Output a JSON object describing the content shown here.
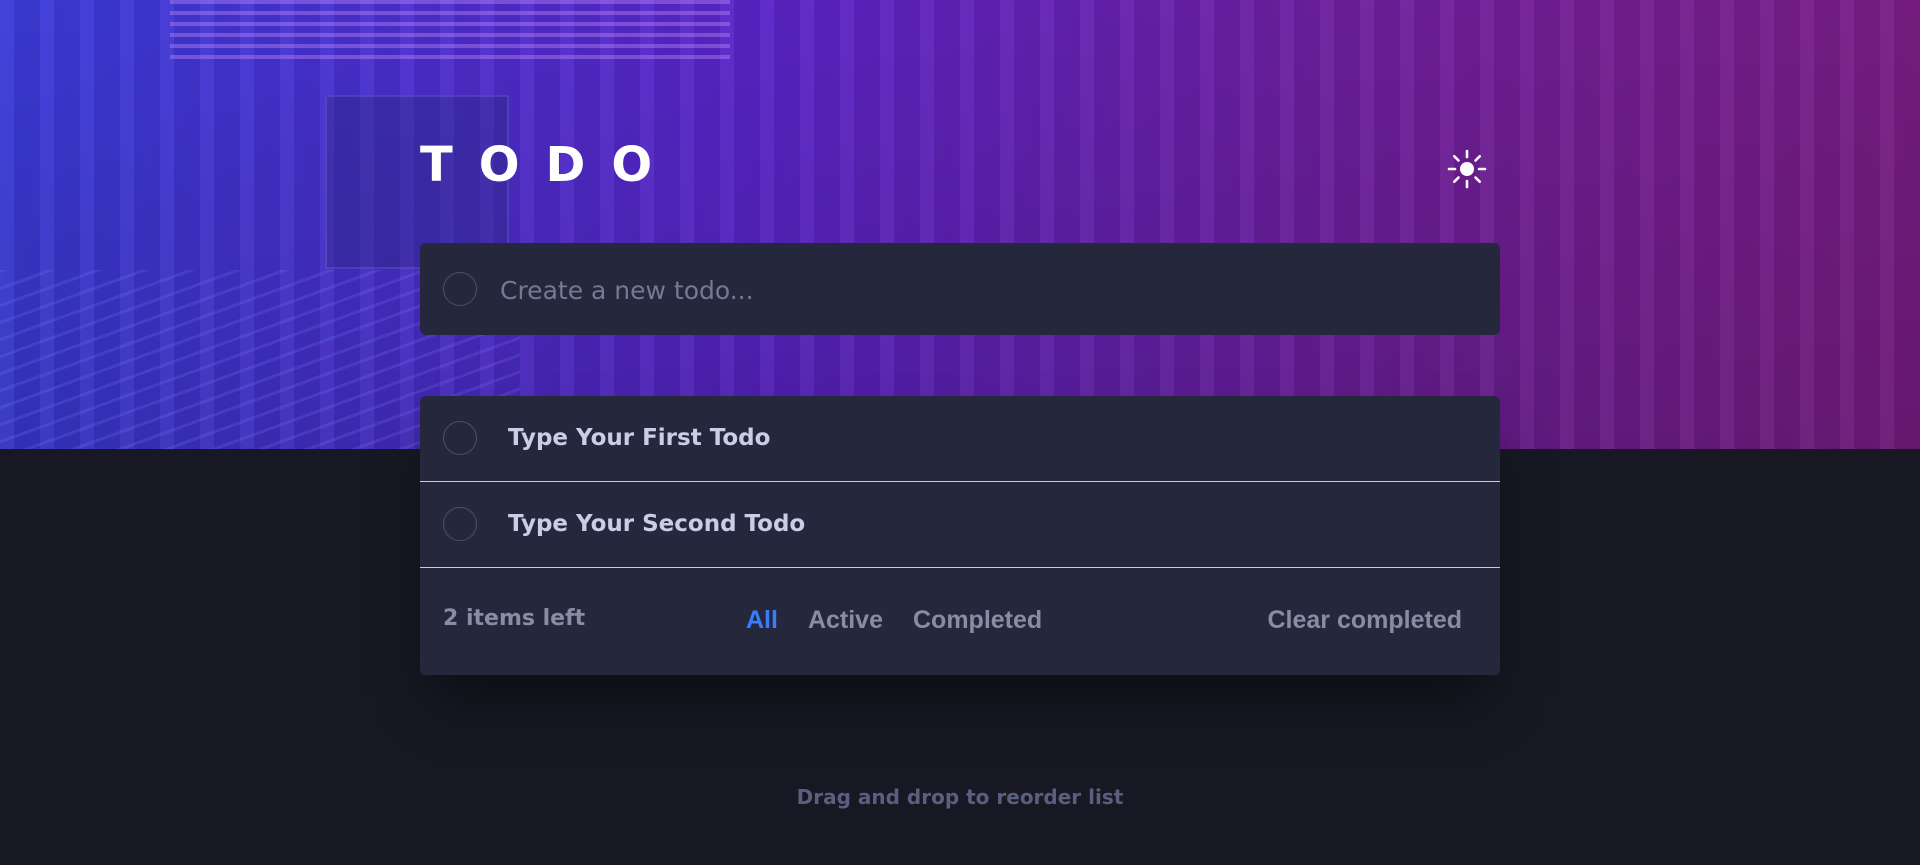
{
  "app": {
    "title": "TODO",
    "theme_toggle_icon": "sun-icon"
  },
  "new_todo": {
    "placeholder": "Create a new todo..."
  },
  "todos": [
    {
      "text": "Type Your First Todo",
      "completed": false
    },
    {
      "text": "Type Your Second Todo",
      "completed": false
    }
  ],
  "footer": {
    "items_left": "2 items left",
    "filters": {
      "all": "All",
      "active": "Active",
      "completed": "Completed"
    },
    "active_filter": "All",
    "clear_completed": "Clear completed"
  },
  "hint": "Drag and drop to reorder list",
  "colors": {
    "accent": "#3a7cfd",
    "card": "#25273d",
    "background": "#181824",
    "gradient_start": "#3a3bd9",
    "gradient_end": "#7a1d85"
  }
}
